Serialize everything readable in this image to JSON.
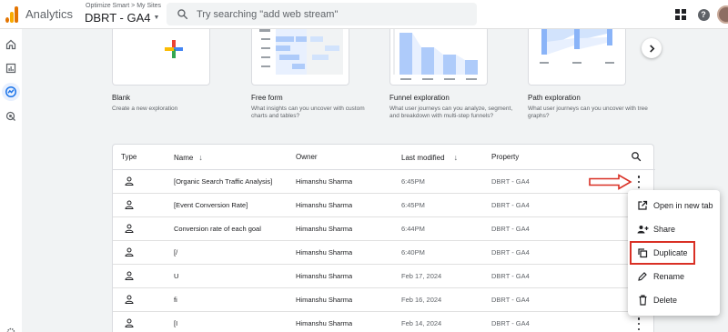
{
  "header": {
    "app_title": "Analytics",
    "breadcrumb": "Optimize Smart > My Sites",
    "property": "DBRT - GA4",
    "search_placeholder": "Try searching \"add web stream\""
  },
  "templates": [
    {
      "name": "Blank",
      "description": "Create a new exploration"
    },
    {
      "name": "Free form",
      "description": "What insights can you uncover with custom charts and tables?"
    },
    {
      "name": "Funnel exploration",
      "description": "What user journeys can you analyze, segment, and breakdown with multi-step funnels?"
    },
    {
      "name": "Path exploration",
      "description": "What user journeys can you uncover with tree graphs?"
    }
  ],
  "table": {
    "columns": {
      "type": "Type",
      "name": "Name",
      "owner": "Owner",
      "last_modified": "Last modified",
      "property": "Property"
    },
    "rows": [
      {
        "name": "[Organic Search Traffic Analysis]",
        "owner": "Himanshu Sharma",
        "modified": "6:45PM",
        "property": "DBRT - GA4"
      },
      {
        "name": "[Event Conversion Rate]",
        "owner": "Himanshu Sharma",
        "modified": "6:45PM",
        "property": "DBRT - GA4"
      },
      {
        "name": "Conversion rate of each goal",
        "owner": "Himanshu Sharma",
        "modified": "6:44PM",
        "property": "DBRT - GA4"
      },
      {
        "name": "[/",
        "owner": "Himanshu Sharma",
        "modified": "6:40PM",
        "property": "DBRT - GA4"
      },
      {
        "name": "U",
        "owner": "Himanshu Sharma",
        "modified": "Feb 17, 2024",
        "property": "DBRT - GA4"
      },
      {
        "name": "fi",
        "owner": "Himanshu Sharma",
        "modified": "Feb 16, 2024",
        "property": "DBRT - GA4"
      },
      {
        "name": "[I",
        "owner": "Himanshu Sharma",
        "modified": "Feb 14, 2024",
        "property": "DBRT - GA4"
      }
    ]
  },
  "menu": {
    "items": [
      "Open in new tab",
      "Share",
      "Duplicate",
      "Rename",
      "Delete"
    ]
  },
  "colors": {
    "accent_blue": "#1a73e8",
    "annotation_red": "#d93025",
    "logo_orange": "#e37400",
    "logo_yellow": "#f9ab00"
  }
}
